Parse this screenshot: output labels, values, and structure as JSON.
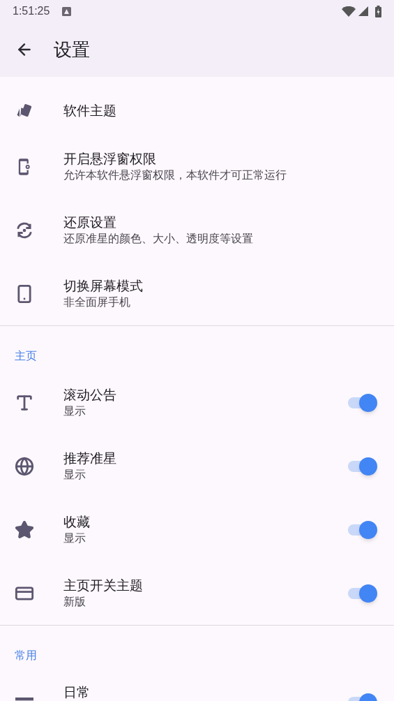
{
  "status_bar": {
    "time": "1:51:25"
  },
  "app_bar": {
    "title": "设置"
  },
  "sections": [
    {
      "items": [
        {
          "kind": "plain",
          "title": "软件主题"
        },
        {
          "kind": "plain",
          "title": "开启悬浮窗权限",
          "subtitle": "允许本软件悬浮窗权限，本软件才可正常运行"
        },
        {
          "kind": "plain",
          "title": "还原设置",
          "subtitle": "还原准星的颜色、大小、透明度等设置"
        },
        {
          "kind": "plain",
          "title": "切换屏幕模式",
          "subtitle": "非全面屏手机"
        }
      ]
    },
    {
      "header": "主页",
      "items": [
        {
          "kind": "toggle",
          "title": "滚动公告",
          "subtitle": "显示",
          "on": true
        },
        {
          "kind": "toggle",
          "title": "推荐准星",
          "subtitle": "显示",
          "on": true
        },
        {
          "kind": "toggle",
          "title": "收藏",
          "subtitle": "显示",
          "on": true
        },
        {
          "kind": "toggle",
          "title": "主页开关主题",
          "subtitle": "新版",
          "on": true
        }
      ]
    },
    {
      "header": "常用",
      "items": [
        {
          "kind": "toggle",
          "title": "日常",
          "on": true
        }
      ]
    }
  ]
}
